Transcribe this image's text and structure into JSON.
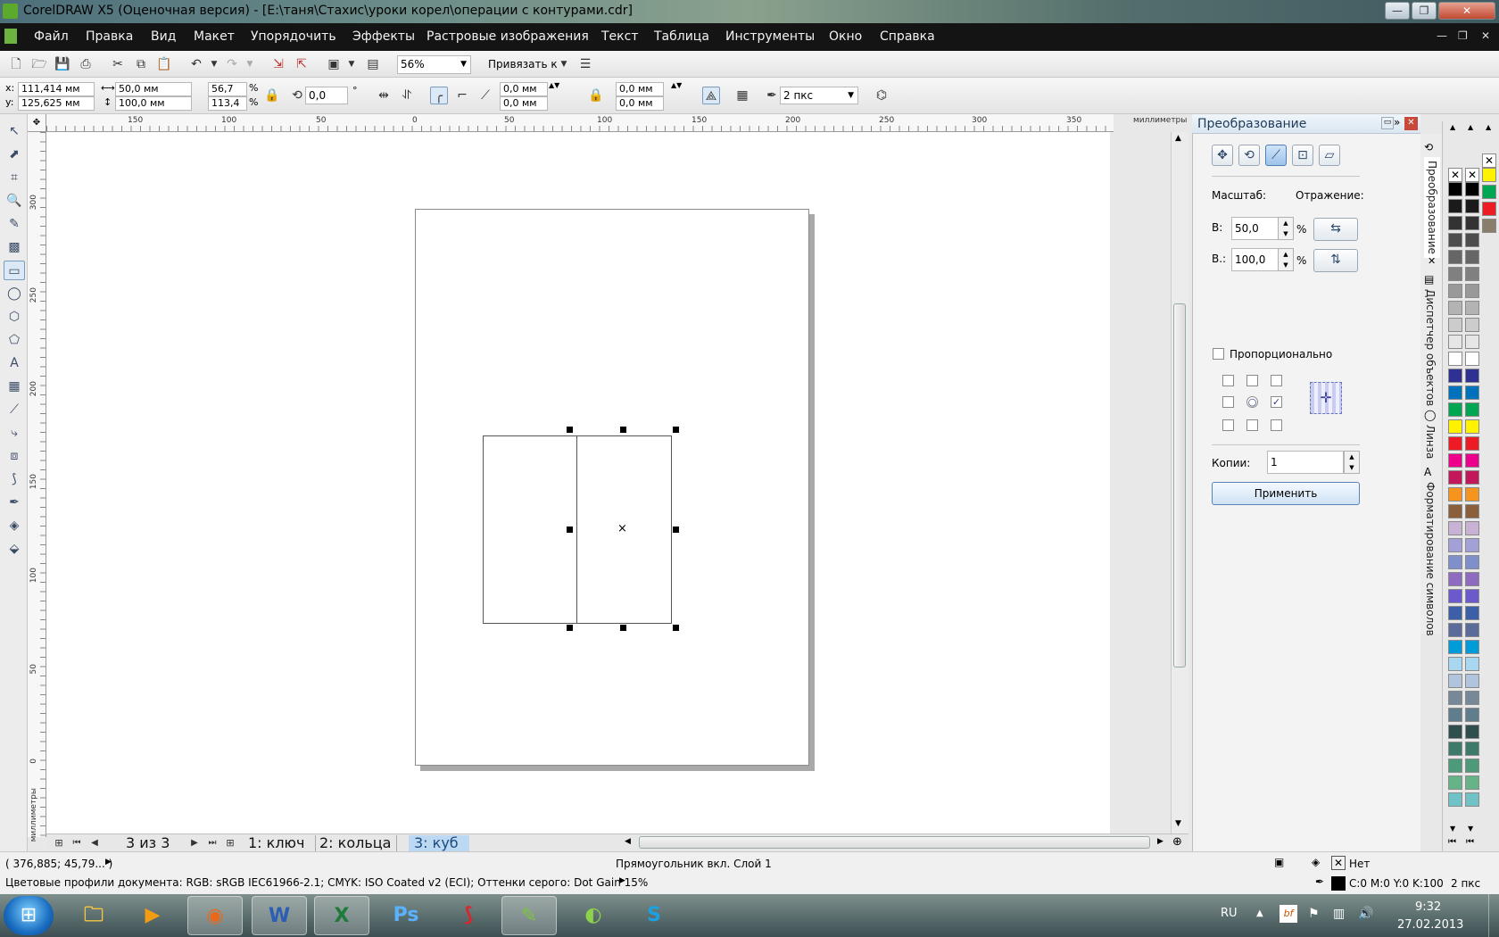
{
  "window": {
    "title": "CorelDRAW X5 (Оценочная версия) - [E:\\таня\\Стахис\\уроки корел\\операции с контурами.cdr]"
  },
  "menu": [
    "Файл",
    "Правка",
    "Вид",
    "Макет",
    "Упорядочить",
    "Эффекты",
    "Растровые изображения",
    "Текст",
    "Таблица",
    "Инструменты",
    "Окно",
    "Справка"
  ],
  "toolbar": {
    "zoom": "56%",
    "snap_label": "Привязать к"
  },
  "propbar": {
    "x_label": "x:",
    "x_value": "111,414 мм",
    "y_label": "y:",
    "y_value": "125,625 мм",
    "w_value": "50,0 мм",
    "h_value": "100,0 мм",
    "scale_w": "56,7",
    "scale_h": "113,4",
    "pct": "%",
    "angle": "0,0",
    "deg": "°",
    "corner1": "0,0 мм",
    "corner2": "0,0 мм",
    "corner3": "0,0 мм",
    "corner4": "0,0 мм",
    "outline": "2 пкс"
  },
  "ruler": {
    "units": "миллиметры",
    "h_ticks": [
      "150",
      "100",
      "50",
      "0",
      "50",
      "100",
      "150",
      "200",
      "250",
      "300",
      "350"
    ],
    "v_ticks": [
      "300",
      "250",
      "200",
      "150",
      "100",
      "50",
      "0"
    ]
  },
  "pages": {
    "counter": "3 из 3",
    "tabs": [
      "1: ключ",
      "2: кольца",
      "3: куб"
    ],
    "active": "3: куб"
  },
  "docker": {
    "title": "Преобразование",
    "scale_label": "Масштаб:",
    "mirror_label": "Отражение:",
    "w_label": "В:",
    "w_value": "50,0",
    "h_label": "В.:",
    "h_value": "100,0",
    "pct": "%",
    "proportional": "Пропорционально",
    "copies_label": "Копии:",
    "copies_value": "1",
    "apply": "Применить",
    "side_tabs": [
      "Преобразование",
      "Диспетчер объектов",
      "Линза",
      "Форматирование символов"
    ]
  },
  "palette": {
    "col1": [
      "#000000",
      "#1a1a1a",
      "#333333",
      "#4d4d4d",
      "#666666",
      "#808080",
      "#999999",
      "#b3b3b3",
      "#cccccc",
      "#e6e6e6",
      "#ffffff",
      "#2e3192",
      "#0072bc",
      "#00a651",
      "#fff200",
      "#ed1c24",
      "#ec008c",
      "#c2185b",
      "#f7941d",
      "#8b5e3c",
      "#c7b2d6",
      "#a3a0d8",
      "#7f8fcc",
      "#8e6bbf",
      "#6a5acd",
      "#3c5fa8",
      "#5b6b9a",
      "#009bd9",
      "#a7d8f0",
      "#b0c4de",
      "#778899",
      "#5f7d8c",
      "#2f4f4f",
      "#3d7a6a",
      "#4c9a7a",
      "#66b388",
      "#6fc2c6"
    ],
    "col2": [
      "#000000",
      "#1a1a1a",
      "#333333",
      "#4d4d4d",
      "#666666",
      "#808080",
      "#999999",
      "#b3b3b3",
      "#cccccc",
      "#e6e6e6",
      "#ffffff",
      "#2e3192",
      "#0072bc",
      "#00a651",
      "#fff200",
      "#ed1c24",
      "#ec008c",
      "#c2185b",
      "#f7941d",
      "#8b5e3c",
      "#c7b2d6",
      "#a3a0d8",
      "#7f8fcc",
      "#8e6bbf",
      "#6a5acd",
      "#3c5fa8",
      "#5b6b9a",
      "#009bd9",
      "#a7d8f0",
      "#b0c4de",
      "#778899",
      "#5f7d8c",
      "#2f4f4f",
      "#3d7a6a",
      "#4c9a7a",
      "#66b388",
      "#6fc2c6"
    ],
    "col3": [
      "#fff200",
      "#00a651",
      "#ed1c24",
      "#8b7d6b"
    ]
  },
  "status": {
    "coords": "( 376,885; 45,79... )",
    "object_info": "Прямоугольник вкл. Слой 1",
    "color_profiles": "Цветовые профили документа: RGB: sRGB IEC61966-2.1; CMYK: ISO Coated v2 (ECI); Оттенки серого: Dot Gain 15%",
    "fill": "Нет",
    "outline_color": "C:0 M:0 Y:0 K:100",
    "outline_width": "2 пкс"
  },
  "taskbar": {
    "lang": "RU",
    "time": "9:32",
    "date": "27.02.2013"
  }
}
